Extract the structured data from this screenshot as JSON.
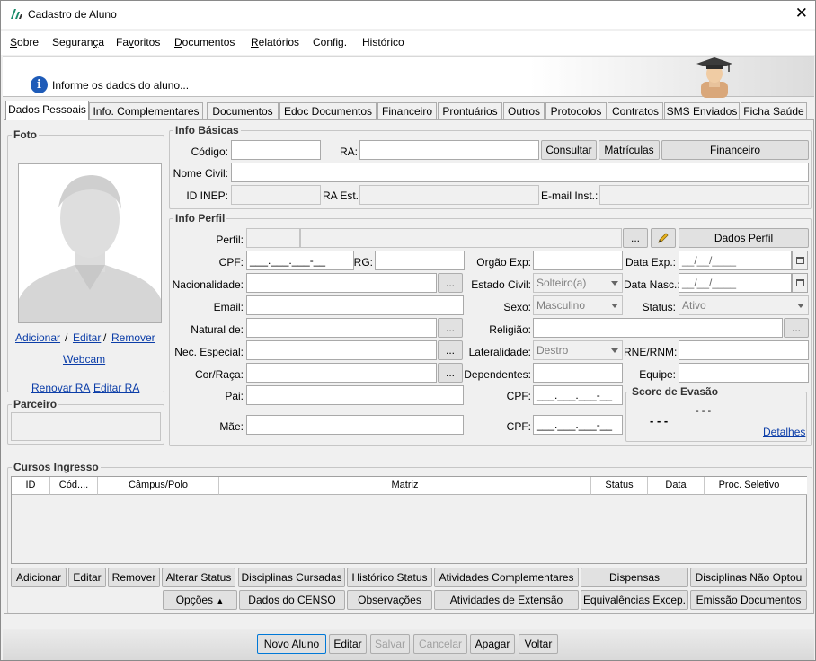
{
  "window": {
    "title": "Cadastro de Aluno"
  },
  "menu": [
    {
      "pre": "",
      "u": "S",
      "post": "obre"
    },
    {
      "pre": "Seguran",
      "u": "ç",
      "post": "a"
    },
    {
      "pre": "Fa",
      "u": "v",
      "post": "oritos"
    },
    {
      "pre": "",
      "u": "D",
      "post": "ocumentos"
    },
    {
      "pre": "",
      "u": "R",
      "post": "elatórios"
    },
    {
      "pre": "Config.",
      "u": "",
      "post": ""
    },
    {
      "pre": "Histórico",
      "u": "",
      "post": ""
    }
  ],
  "banner": {
    "text": "Informe os dados do aluno..."
  },
  "tabs": [
    "Dados Pessoais",
    "Info. Complementares",
    "Documentos",
    "Edoc Documentos",
    "Financeiro",
    "Prontuários",
    "Outros",
    "Protocolos",
    "Contratos",
    "SMS Enviados",
    "Ficha Saúde"
  ],
  "foto": {
    "legend": "Foto",
    "adicionar": "Adicionar",
    "sep1": "/",
    "editar": "Editar",
    "sep2": "/",
    "remover": "Remover",
    "webcam": "Webcam",
    "renovar_ra": "Renovar RA",
    "editar_ra": "Editar RA"
  },
  "parceiro": {
    "legend": "Parceiro"
  },
  "basicas": {
    "legend": "Info Básicas",
    "codigo": "Código:",
    "ra": "RA:",
    "consultar": "Consultar",
    "matriculas": "Matrículas",
    "financeiro": "Financeiro",
    "nome_civil": "Nome Civil:",
    "id_inep": "ID INEP:",
    "ra_est": "RA Est.:",
    "email_inst": "E-mail Inst.:"
  },
  "perfil": {
    "legend": "Info Perfil",
    "perfil": "Perfil:",
    "dots": "...",
    "dados_perfil": "Dados Perfil",
    "cpf": "CPF:",
    "cpf_value": "___.___.___-__",
    "rg": "RG:",
    "orgao_exp": "Orgão Exp:",
    "data_exp": "Data Exp.:",
    "date_placeholder": "__/__/____",
    "nacionalidade": "Nacionalidade:",
    "estado_civil": "Estado Civil:",
    "estado_civil_value": "Solteiro(a)",
    "data_nasc": "Data Nasc.:",
    "email": "Email:",
    "sexo": "Sexo:",
    "sexo_value": "Masculino",
    "status": "Status:",
    "status_value": "Ativo",
    "natural_de": "Natural de:",
    "religiao": "Religião:",
    "nec_especial": "Nec. Especial:",
    "lateralidade": "Lateralidade:",
    "lateralidade_value": "Destro",
    "rne": "RNE/RNM:",
    "cor_raca": "Cor/Raça:",
    "dependentes": "Dependentes:",
    "equipe": "Equipe:",
    "pai": "Pai:",
    "mae": "Mãe:",
    "cpf_pai": "CPF:",
    "cpf_mae": "CPF:"
  },
  "score": {
    "legend": "Score de Evasão",
    "value": "- - -",
    "sub": "- - -",
    "detalhes": "Detalhes"
  },
  "cursos": {
    "legend": "Cursos Ingresso",
    "columns": [
      "ID",
      "Cód....",
      "Câmpus/Polo",
      "Matriz",
      "Status",
      "Data",
      "Proc. Seletivo"
    ]
  },
  "actions_row1": [
    "Adicionar",
    "Editar",
    "Remover",
    "Alterar Status",
    "Disciplinas Cursadas",
    "Histórico Status",
    "Atividades Complementares",
    "Dispensas",
    "Disciplinas Não Optou"
  ],
  "actions_row2": [
    "Opções",
    "Dados do CENSO",
    "Observações",
    "Atividades de Extensão",
    "Equivalências Excep.",
    "Emissão Documentos"
  ],
  "bottom": [
    "Novo Aluno",
    "Editar",
    "Salvar",
    "Cancelar",
    "Apagar",
    "Voltar"
  ]
}
